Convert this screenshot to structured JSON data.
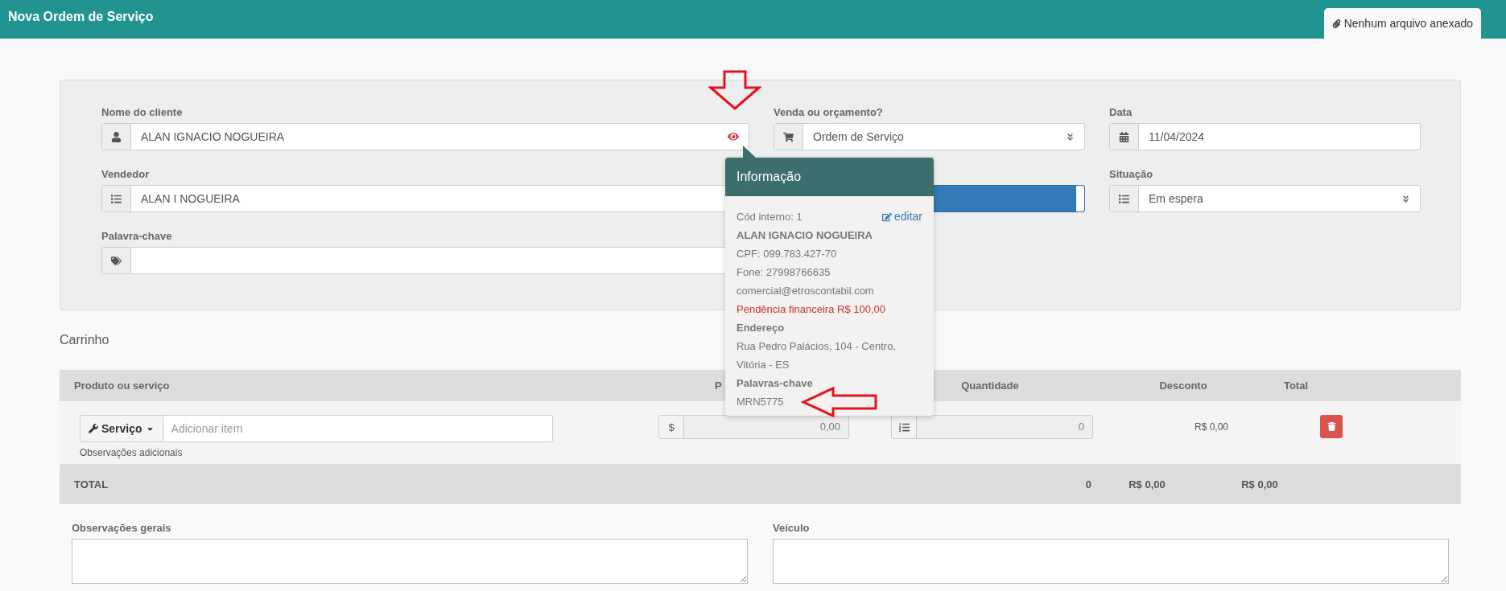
{
  "header": {
    "title": "Nova Ordem de Serviço",
    "attachment_tab": "Nenhum arquivo anexado"
  },
  "form": {
    "rows": [
      [
        {
          "kind": "client",
          "label": "Nome do cliente",
          "value": "ALAN IGNACIO NOGUEIRA"
        },
        {
          "kind": "select",
          "label": "Venda ou orçamento?",
          "value": "Ordem de Serviço"
        },
        {
          "kind": "date",
          "label": "Data",
          "value": "11/04/2024"
        }
      ],
      [
        {
          "kind": "seller",
          "label": "Vendedor",
          "value": "ALAN I NOGUEIRA"
        },
        {
          "kind": "highlight"
        },
        {
          "kind": "status",
          "label": "Situação",
          "value": "Em espera"
        }
      ],
      [
        {
          "kind": "keyword",
          "label": "Palavra-chave"
        }
      ]
    ]
  },
  "popover": {
    "title": "Informação",
    "code": "Cód interno: 1",
    "edit_link": "editar",
    "name": "ALAN IGNACIO NOGUEIRA",
    "cpf": "CPF: 099.783.427-70",
    "phone": "Fone: 27998766635",
    "email": "comercial@etroscontabil.com",
    "alert": "Pendência financeira R$ 100,00",
    "address_heading": "Endereço",
    "address": "Rua Pedro Palácios, 104 - Centro, Vitória - ES",
    "keywords_heading": "Palavras-chave",
    "keywords": "MRN5775"
  },
  "cart": {
    "title": "Carrinho",
    "columns": [
      "Produto ou serviço",
      "P",
      "Quantidade",
      "Desconto",
      "Total"
    ],
    "item": {
      "type_button": "Serviço",
      "placeholder": "Adicionar item",
      "notes_link": "Observações adicionais",
      "price_symbol": "$",
      "price": "0,00",
      "quantity": "0",
      "discount": "R$ 0,00"
    },
    "total": {
      "label": "TOTAL",
      "quantity": "0",
      "discount": "R$ 0,00",
      "total": "R$ 0,00"
    }
  },
  "bottom": {
    "notes_label": "Observações gerais",
    "vehicle_label": "Veículo"
  }
}
